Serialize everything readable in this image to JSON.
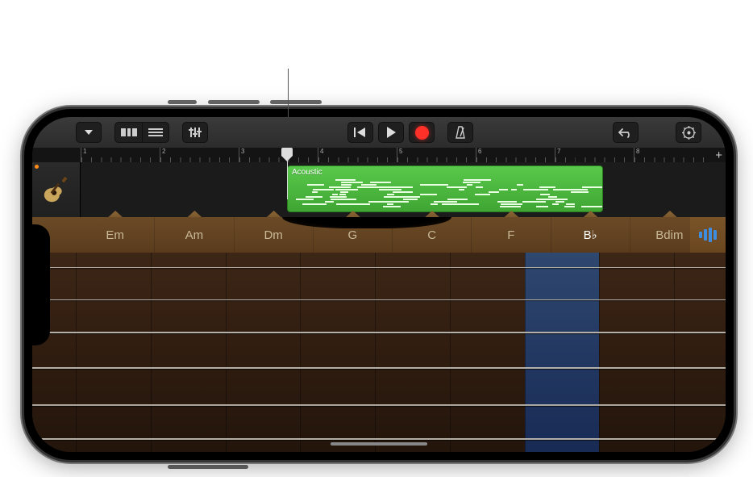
{
  "toolbar": {
    "browser_label": "browser",
    "view_track_label": "view-tracks",
    "view_editor_label": "view-editor",
    "mixer_label": "mixer",
    "rewind_label": "go-to-beginning",
    "play_label": "play",
    "record_label": "record",
    "metronome_label": "metronome",
    "undo_label": "undo",
    "settings_label": "settings",
    "add_marker_label": "+"
  },
  "ruler": {
    "bars": [
      "1",
      "2",
      "3",
      "4",
      "5",
      "6",
      "7",
      "8"
    ]
  },
  "track": {
    "instrument": "Acoustic Guitar",
    "region_name": "Acoustic"
  },
  "chords": [
    "Em",
    "Am",
    "Dm",
    "G",
    "C",
    "F",
    "B♭",
    "Bdim"
  ],
  "chord_held_index": 6,
  "colors": {
    "region": "#4cb93f",
    "record": "#ff3028",
    "chord_highlight": "#2e67b8"
  }
}
